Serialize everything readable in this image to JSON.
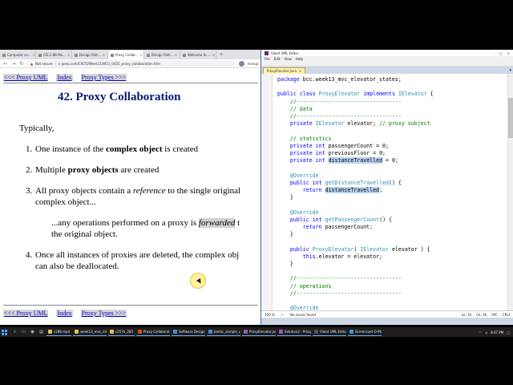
{
  "browser": {
    "tabs": [
      {
        "label": "Computer so..."
      },
      {
        "label": "CIS 2.8B Mo..."
      },
      {
        "label": "Design Patt..."
      },
      {
        "label": "Proxy Collab..."
      },
      {
        "label": "Design Patt..."
      },
      {
        "label": "Welcome to ..."
      }
    ],
    "new_tab": "+",
    "secure_label": "Not secure",
    "url": "c-jump.com/CIS75/Week11/W11_0425_proxy_collaboration.htm",
    "extra_label": "Instagr..."
  },
  "page": {
    "nav": {
      "prev": "<<< Proxy UML",
      "index": "Index",
      "next": "Proxy Types >>>"
    },
    "title": "42. Proxy Collaboration",
    "intro": "Typically,",
    "items": [
      {
        "num": "1.",
        "pre": "One instance of the ",
        "bold": "complex object",
        "post": " is created"
      },
      {
        "num": "2.",
        "pre": "Multiple ",
        "bold": "proxy objects",
        "post": " are created"
      },
      {
        "num": "3.",
        "pre": "All proxy objects contain a ",
        "ital": "reference",
        "post": " to the single original",
        "line2": "complex object..."
      },
      {
        "num": "4.",
        "pre": "Once all instances of proxies are deleted, the complex obj",
        "line2": "can also be deallocated."
      }
    ],
    "forward_pre": "...any operations performed on a proxy is ",
    "forward_word": "forwarded",
    "forward_post": " t",
    "forward_line2": "the original object."
  },
  "ide": {
    "title": "Violet UML Editor",
    "menu": [
      "File",
      "Edit",
      "View",
      "Help"
    ],
    "tab_label": "ProxyElevator.java",
    "status_left": "No issues found",
    "status_pos": "Ln: 34",
    "status_col": "Ch: 36",
    "status_mode": "SPC",
    "status_enc": "CRLF",
    "zoom": "100 %",
    "code_lines": [
      "package bcc.week13_mvc_elevator_states;",
      "",
      "public class ProxyElevator implements IElevator {",
      "    //---------------------------------",
      "    // data",
      "    //---------------------------------",
      "    private IElevator elevator; // proxy subject",
      "",
      "    // statistics",
      "    private int passengerCount = 0;",
      "    private int previousFloor = 0;",
      "    private int distanceTravelled = 0;",
      "",
      "    @Override",
      "    public int getDistanceTravelled() {",
      "        return distanceTravelled;",
      "    }",
      "",
      "    @Override",
      "    public int getPassengerCount() {",
      "        return passengerCount;",
      "    }",
      "",
      "    public ProxyElevator( IElevator elevator ) {",
      "        this.elevator = elevator;",
      "    }",
      "",
      "    //---------------------------------",
      "    // operations",
      "    //---------------------------------",
      "",
      "    @Override"
    ]
  },
  "taskbar": {
    "apps": [
      {
        "label": "c288.mp4",
        "color": "#e8c24a"
      },
      {
        "label": "week13_mvc_eler...",
        "color": "#e8c24a"
      },
      {
        "label": "c257a_285",
        "color": "#e8c24a"
      },
      {
        "label": "Proxy Collaborati...",
        "color": "#d35400"
      },
      {
        "label": "Software Design ...",
        "color": "#4a8fd6"
      },
      {
        "label": "bomic_sample_co...",
        "color": "#4a8fd6"
      },
      {
        "label": "ProxyElevator.jav...",
        "color": "#9b59b6"
      },
      {
        "label": "Solution3 - Proxy...",
        "color": "#9b59b6"
      },
      {
        "label": "Violet UML Editor",
        "color": "#555555"
      },
      {
        "label": "Screencast-O-Ma...",
        "color": "#3498db"
      }
    ],
    "time": "8:47 PM"
  }
}
